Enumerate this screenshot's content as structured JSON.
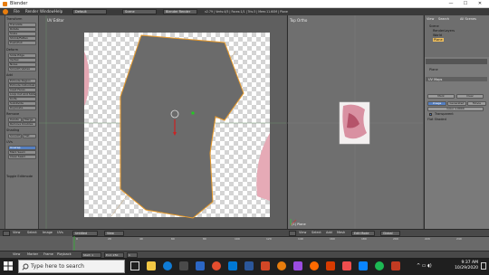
{
  "window": {
    "title": "Blender",
    "minimize": "—",
    "maximize": "☐",
    "close": "✕"
  },
  "topbar": {
    "menus": [
      "File",
      "Render",
      "Window",
      "Help"
    ],
    "layout": "Default",
    "scene": "Scene",
    "engine": "Blender Render",
    "stats": "v2.79 | Verts:4/5 | Faces:1/1 | Tris:3 | Mem:11.60M | Plane"
  },
  "leftshelf": {
    "sections": [
      {
        "head": "Transform",
        "items": [
          "Translate",
          "Rotate",
          "Scale",
          "Shrink/Fatten",
          "Push/Pull"
        ]
      },
      {
        "head": "Deform",
        "items": [
          "Slide Edge",
          "Vertex",
          "Noise",
          "Smooth Vertex"
        ]
      },
      {
        "head": "Add",
        "items": [
          "Extrude Region",
          "Extrude Individual",
          "Inset Faces",
          "Loop Cut and Slide",
          "Knife",
          "Subdivide",
          "Duplicate"
        ]
      },
      {
        "head": "Remove",
        "items": [
          "Delete",
          "Merge",
          "Remove Doubles"
        ]
      },
      {
        "head": "Shading",
        "items": [
          "Smooth",
          "Flat"
        ]
      },
      {
        "head": "UVs",
        "items": [
          "Unwrap",
          "Mark Seam",
          "Clear Seam"
        ]
      }
    ],
    "footer": "Toggle Editmode"
  },
  "uv_editor": {
    "label": "UV Editor",
    "header_items": [
      "View",
      "Select",
      "Image",
      "UVs"
    ],
    "image_name": "Untitled",
    "mode": "View"
  },
  "viewport": {
    "label": "Top Ortho",
    "corner": "(1) Plane",
    "header_items": [
      "View",
      "Select",
      "Add",
      "Mesh"
    ],
    "mode": "Edit Mode",
    "pivot": "Global"
  },
  "outliner": {
    "header": [
      "View",
      "Search",
      "All Scenes"
    ],
    "items": [
      "Scene",
      "RenderLayers",
      "World",
      "Plane"
    ]
  },
  "properties": {
    "object_name": "Plane",
    "section": "UV Maps",
    "buttons": [
      "Mark",
      "Clear"
    ],
    "tabs": [
      "Image",
      "Generated",
      "Movie"
    ],
    "source": "Generated",
    "alpha_label": "Transparent",
    "field": "Color 1.0000",
    "footer": "Flat Shaded"
  },
  "timeline": {
    "header_items": [
      "View",
      "Marker",
      "Frame",
      "Playback"
    ],
    "start_label": "Start: 1",
    "end_label": "End: 250",
    "current": "1",
    "ticks": [
      "0",
      "20",
      "40",
      "60",
      "80",
      "100",
      "120",
      "140",
      "160",
      "180",
      "200",
      "220",
      "240"
    ]
  },
  "taskbar": {
    "search_placeholder": "Type here to search",
    "time": "9:37 AM",
    "date": "10/29/2020"
  },
  "colors": {
    "accent": "#5680c2",
    "uv_outline": "#e89a2a",
    "mesh_fill": "#6b6b6b",
    "texture_pink": "#e7b3be",
    "blender_orange": "#e87d0d"
  }
}
